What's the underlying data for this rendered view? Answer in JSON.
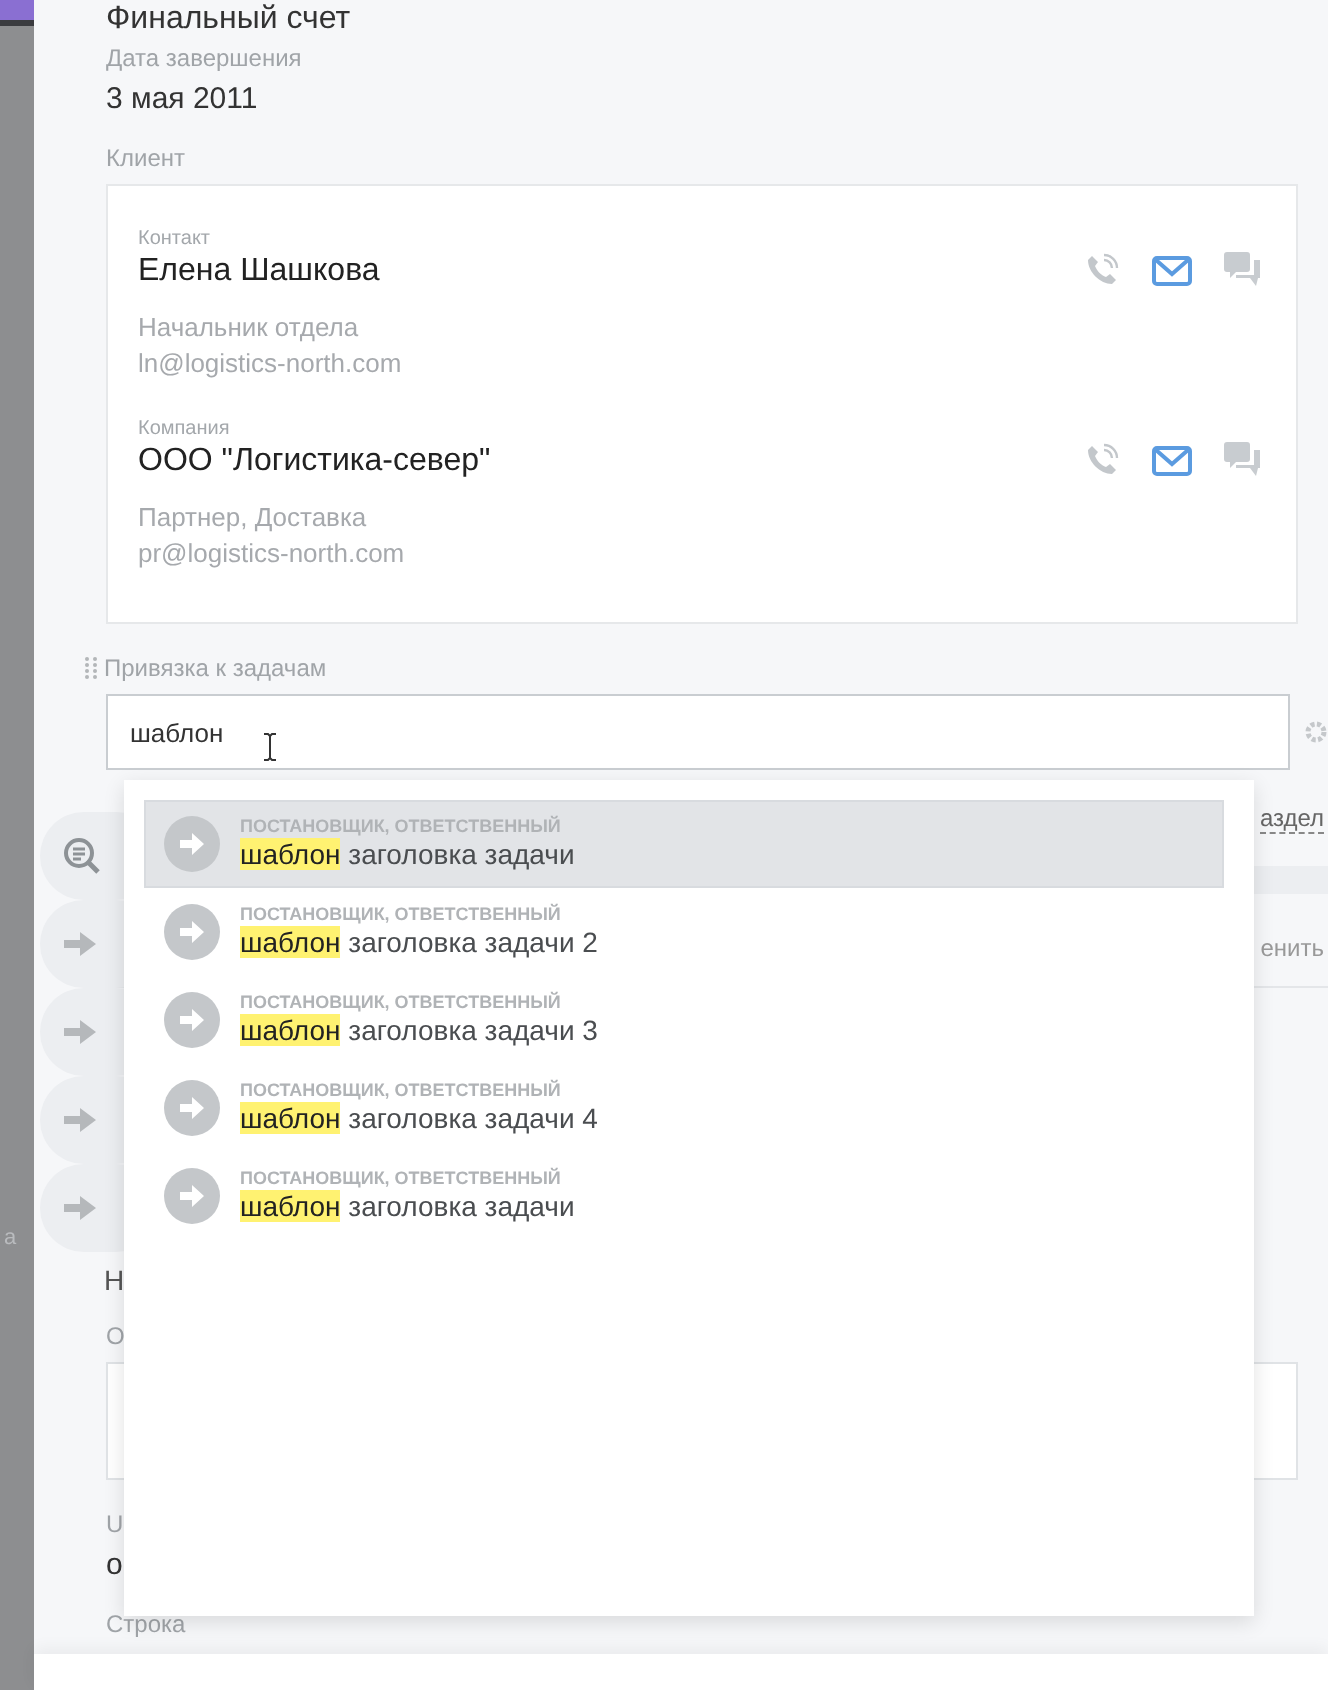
{
  "sidebar_fragment": "а",
  "top_title": "Финальный счет",
  "due_date": {
    "label": "Дата завершения",
    "value": "3 мая 2011"
  },
  "client": {
    "label": "Клиент",
    "entries": [
      {
        "kind_label": "Контакт",
        "name": "Елена Шашкова",
        "position": "Начальник отдела",
        "email": "ln@logistics-north.com"
      },
      {
        "kind_label": "Компания",
        "name": "ООО \"Логистика-север\"",
        "position": "Партнер, Доставка",
        "email": "pr@logistics-north.com"
      }
    ]
  },
  "tasks": {
    "label": "Привязка к задачам",
    "value": "шаблон"
  },
  "suggestions": [
    {
      "roles": "ПОСТАНОВЩИК, ОТВЕТСТВЕННЫЙ",
      "match": "шаблон",
      "rest": " заголовка задачи",
      "selected": true
    },
    {
      "roles": "ПОСТАНОВЩИК, ОТВЕТСТВЕННЫЙ",
      "match": "шаблон",
      "rest": " заголовка задачи 2",
      "selected": false
    },
    {
      "roles": "ПОСТАНОВЩИК, ОТВЕТСТВЕННЫЙ",
      "match": "шаблон",
      "rest": " заголовка задачи 3",
      "selected": false
    },
    {
      "roles": "ПОСТАНОВЩИК, ОТВЕТСТВЕННЫЙ",
      "match": "шаблон",
      "rest": " заголовка задачи 4",
      "selected": false
    },
    {
      "roles": "ПОСТАНОВЩИК, ОТВЕТСТВЕННЫЙ",
      "match": "шаблон",
      "rest": " заголовка задачи",
      "selected": false
    }
  ],
  "side_buttons": [
    {
      "kind": "search"
    },
    {
      "kind": "arrow"
    },
    {
      "kind": "arrow"
    },
    {
      "kind": "arrow"
    },
    {
      "kind": "arrow"
    }
  ],
  "behind_dropdown": {
    "link": "аздел",
    "tab": "енить",
    "heading": "Н",
    "label_2": "О",
    "label_3": "U",
    "value_3": "о",
    "label_4": "Строка"
  }
}
